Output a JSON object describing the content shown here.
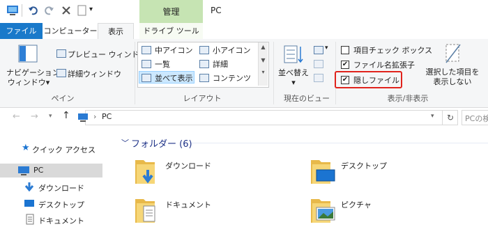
{
  "titlebar": {
    "context_tab_label": "管理",
    "window_title": "PC"
  },
  "tabs": {
    "file": "ファイル",
    "computer": "コンピューター",
    "view": "表示",
    "drive_tools": "ドライブ ツール"
  },
  "ribbon": {
    "pane_group": {
      "navigation_pane_line1": "ナビゲーション",
      "navigation_pane_line2": "ウィンドウ▾",
      "preview_pane": "プレビュー ウィンドウ",
      "details_pane": "詳細ウィンドウ",
      "label": "ペイン"
    },
    "layout_group": {
      "items": [
        "中アイコン",
        "小アイコン",
        "一覧",
        "詳細",
        "並べて表示",
        "コンテンツ"
      ],
      "label": "レイアウト"
    },
    "current_view_group": {
      "sort_by_line1": "並べ替え",
      "sort_by_line2": "▾",
      "label": "現在のビュー"
    },
    "show_hide_group": {
      "item_checkboxes": {
        "label": "項目チェック ボックス",
        "checked": false
      },
      "file_extensions": {
        "label": "ファイル名拡張子",
        "checked": true
      },
      "hidden_items": {
        "label": "隠しファイル",
        "checked": true
      },
      "hide_selected_line1": "選択した項目を",
      "hide_selected_line2": "表示しない",
      "label": "表示/非表示"
    }
  },
  "address": {
    "path_root": "PC",
    "search_placeholder": "PCの検"
  },
  "nav_pane": {
    "quick_access": "クイック アクセス",
    "pc": "PC",
    "downloads": "ダウンロード",
    "desktop": "デスクトップ",
    "documents": "ドキュメント"
  },
  "content": {
    "group_header": "フォルダー (6)",
    "folders": [
      "ダウンロード",
      "デスクトップ",
      "ドキュメント",
      "ピクチャ"
    ]
  },
  "colors": {
    "file_tab": "#1979ca",
    "context_tab": "#c6e4b3",
    "highlight": "#e0231c",
    "selection": "#cce8ff"
  }
}
